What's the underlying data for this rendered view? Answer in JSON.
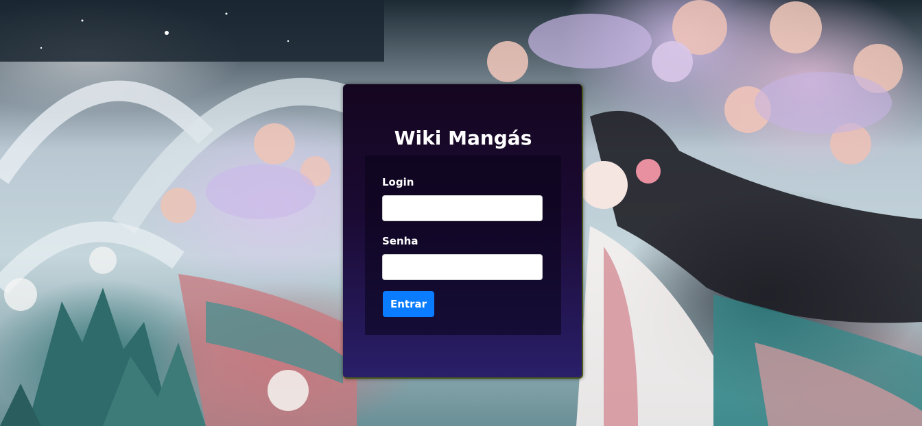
{
  "page": {
    "title": "Wiki Mangás"
  },
  "form": {
    "login_label": "Login",
    "login_value": "",
    "senha_label": "Senha",
    "senha_value": "",
    "submit_label": "Entrar"
  },
  "colors": {
    "panel_top": "#150620",
    "panel_bottom": "#2a1f6a",
    "button_bg": "#0a7cff",
    "text": "#ffffff"
  },
  "background": {
    "description_icon": "anime-illustration-background"
  }
}
